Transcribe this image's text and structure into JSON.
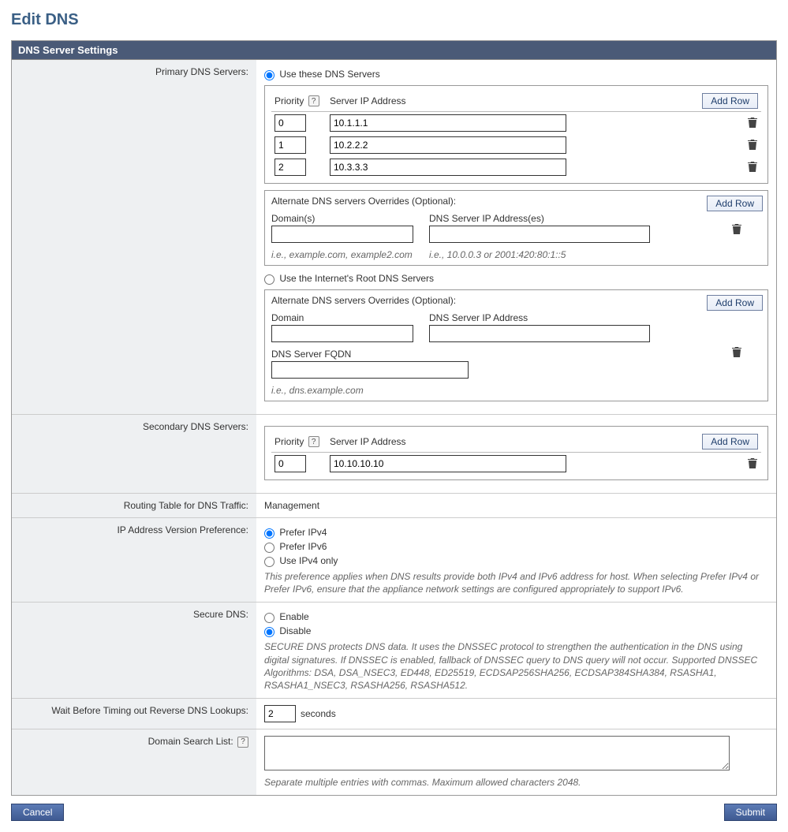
{
  "title": "Edit DNS",
  "panel_title": "DNS Server Settings",
  "labels": {
    "primary": "Primary DNS Servers:",
    "secondary": "Secondary DNS Servers:",
    "routing": "Routing Table for DNS Traffic:",
    "ipver": "IP Address Version Preference:",
    "secure": "Secure DNS:",
    "wait": "Wait Before Timing out Reverse DNS Lookups:",
    "search": "Domain Search List:"
  },
  "common": {
    "add_row": "Add Row",
    "priority": "Priority",
    "server_ip": "Server IP Address",
    "seconds": "seconds"
  },
  "primary": {
    "opt_use_these": "Use these DNS Servers",
    "opt_use_root": "Use the Internet's Root DNS Servers",
    "rows": [
      {
        "priority": "0",
        "ip": "10.1.1.1"
      },
      {
        "priority": "1",
        "ip": "10.2.2.2"
      },
      {
        "priority": "2",
        "ip": "10.3.3.3"
      }
    ],
    "alt1": {
      "title": "Alternate DNS servers Overrides (Optional):",
      "domains_header": "Domain(s)",
      "ips_header": "DNS Server IP Address(es)",
      "domains_hint": "i.e., example.com, example2.com",
      "ips_hint": "i.e., 10.0.0.3 or 2001:420:80:1::5",
      "domains_value": "",
      "ips_value": ""
    },
    "alt2": {
      "title": "Alternate DNS servers Overrides (Optional):",
      "domain_header": "Domain",
      "dns_ip_header": "DNS Server IP Address",
      "fqdn_header": "DNS Server FQDN",
      "fqdn_hint": "i.e., dns.example.com",
      "domain_value": "",
      "dns_ip_value": "",
      "fqdn_value": ""
    }
  },
  "secondary": {
    "rows": [
      {
        "priority": "0",
        "ip": "10.10.10.10"
      }
    ]
  },
  "routing_value": "Management",
  "ipver": {
    "opt1": "Prefer IPv4",
    "opt2": "Prefer IPv6",
    "opt3": "Use IPv4 only",
    "note": "This preference applies when DNS results provide both IPv4 and IPv6 address for host. When selecting Prefer IPv4 or Prefer IPv6, ensure that the appliance network settings are configured appropriately to support IPv6."
  },
  "secure": {
    "opt1": "Enable",
    "opt2": "Disable",
    "note": "SECURE DNS protects DNS data. It uses the DNSSEC protocol to strengthen the authentication in the DNS using digital signatures. If DNSSEC is enabled, fallback of DNSSEC query to DNS query will not occur. Supported DNSSEC Algorithms: DSA, DSA_NSEC3, ED448, ED25519, ECDSAP256SHA256, ECDSAP384SHA384, RSASHA1, RSASHA1_NSEC3, RSASHA256, RSASHA512."
  },
  "wait_value": "2",
  "search_note": "Separate multiple entries with commas. Maximum allowed characters 2048.",
  "footer": {
    "cancel": "Cancel",
    "submit": "Submit"
  }
}
